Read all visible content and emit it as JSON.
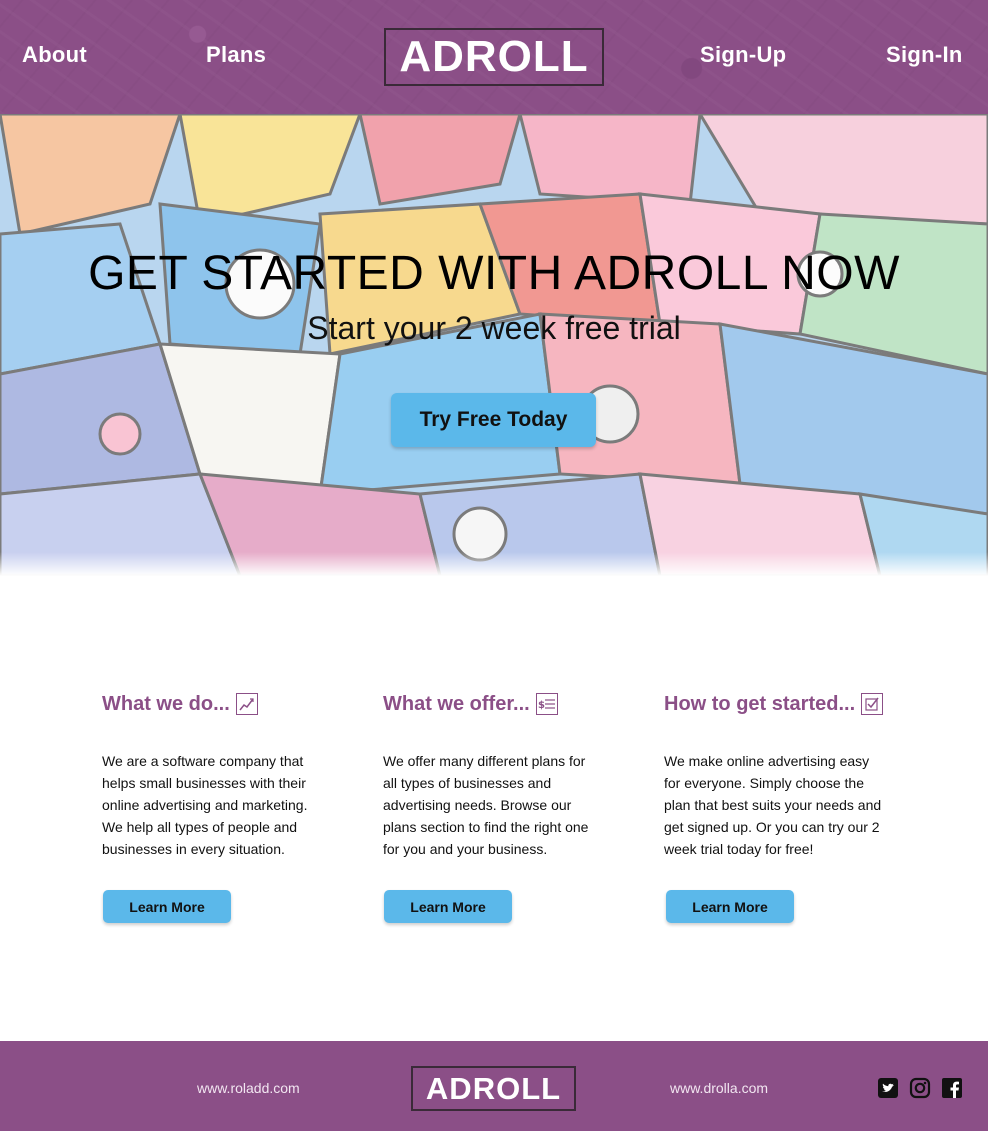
{
  "colors": {
    "brand_purple": "#8b4f87",
    "accent_blue": "#5bb8ea",
    "text_dark": "#111111",
    "background": "#ffffff"
  },
  "header": {
    "nav_left": [
      "About",
      "Plans"
    ],
    "logo": "ADROLL",
    "nav_right": [
      "Sign-Up",
      "Sign-In"
    ]
  },
  "hero": {
    "title": "GET STARTED WITH ADROLL NOW",
    "subtitle": "Start your 2 week free trial",
    "cta_label": "Try Free Today",
    "background_image": "colorful graffiti mural"
  },
  "features": [
    {
      "heading": "What we do...",
      "icon": "chart-trend-icon",
      "body": "We are a software company that helps small businesses with their online advertising and marketing. We help all types of people and businesses in every situation.",
      "button_label": "Learn More"
    },
    {
      "heading": "What we offer...",
      "icon": "price-list-icon",
      "body": "We offer many different plans for all types of businesses and advertising needs. Browse our plans section to find the right one for you and your business.",
      "button_label": "Learn More"
    },
    {
      "heading": "How to get started...",
      "icon": "checkbox-icon",
      "body": "We make online advertising easy for everyone. Simply choose the plan that best suits your needs and get signed up. Or you can try our 2 week trial today for free!",
      "button_label": "Learn More"
    }
  ],
  "footer": {
    "link_left": "www.roladd.com",
    "logo": "ADROLL",
    "link_right": "www.drolla.com",
    "social_icons": [
      "twitter-icon",
      "instagram-icon",
      "facebook-icon"
    ]
  }
}
